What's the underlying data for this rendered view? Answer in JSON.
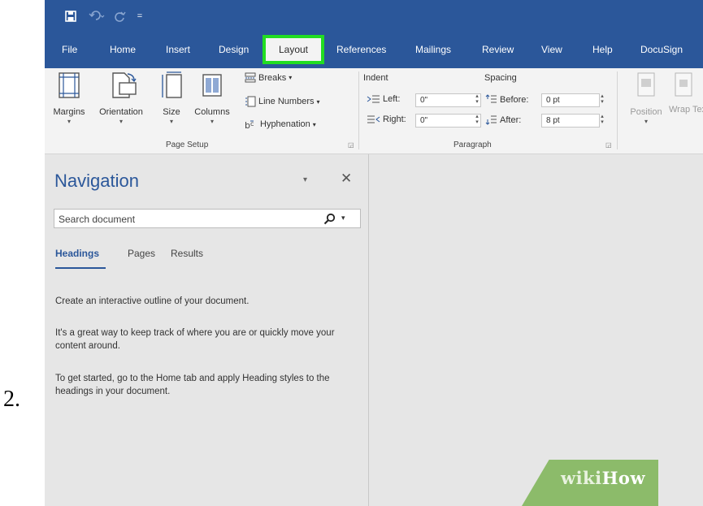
{
  "step_number": "2.",
  "quick_access": {
    "save_icon": "save-icon",
    "undo_icon": "undo-icon",
    "redo_icon": "redo-icon",
    "customize_icon": "customize-qat-icon"
  },
  "tabs": [
    "File",
    "Home",
    "Insert",
    "Design",
    "Layout",
    "References",
    "Mailings",
    "Review",
    "View",
    "Help",
    "DocuSign"
  ],
  "active_tab": "Layout",
  "page_setup": {
    "margins": "Margins",
    "orientation": "Orientation",
    "size": "Size",
    "columns": "Columns",
    "breaks": "Breaks",
    "line_numbers": "Line Numbers",
    "hyphenation": "Hyphenation",
    "group_label": "Page Setup"
  },
  "paragraph": {
    "indent_header": "Indent",
    "spacing_header": "Spacing",
    "left_label": "Left:",
    "left_value": "0\"",
    "right_label": "Right:",
    "right_value": "0\"",
    "before_label": "Before:",
    "before_value": "0 pt",
    "after_label": "After:",
    "after_value": "8 pt",
    "group_label": "Paragraph"
  },
  "arrange": {
    "position": "Position",
    "wrap_text": "Wrap Text"
  },
  "navigation": {
    "title": "Navigation",
    "search_placeholder": "Search document",
    "tabs": [
      "Headings",
      "Pages",
      "Results"
    ],
    "active_tab": "Headings",
    "paragraphs": [
      "Create an interactive outline of your document.",
      "It's a great way to keep track of where you are or quickly move your content around.",
      "To get started, go to the Home tab and apply Heading styles to the headings in your document."
    ]
  },
  "watermark": {
    "wiki": "wiki",
    "how": "How"
  },
  "colors": {
    "ribbon_blue": "#2b579a",
    "highlight_green": "#22dd22",
    "watermark_green": "#8cbb6a"
  }
}
